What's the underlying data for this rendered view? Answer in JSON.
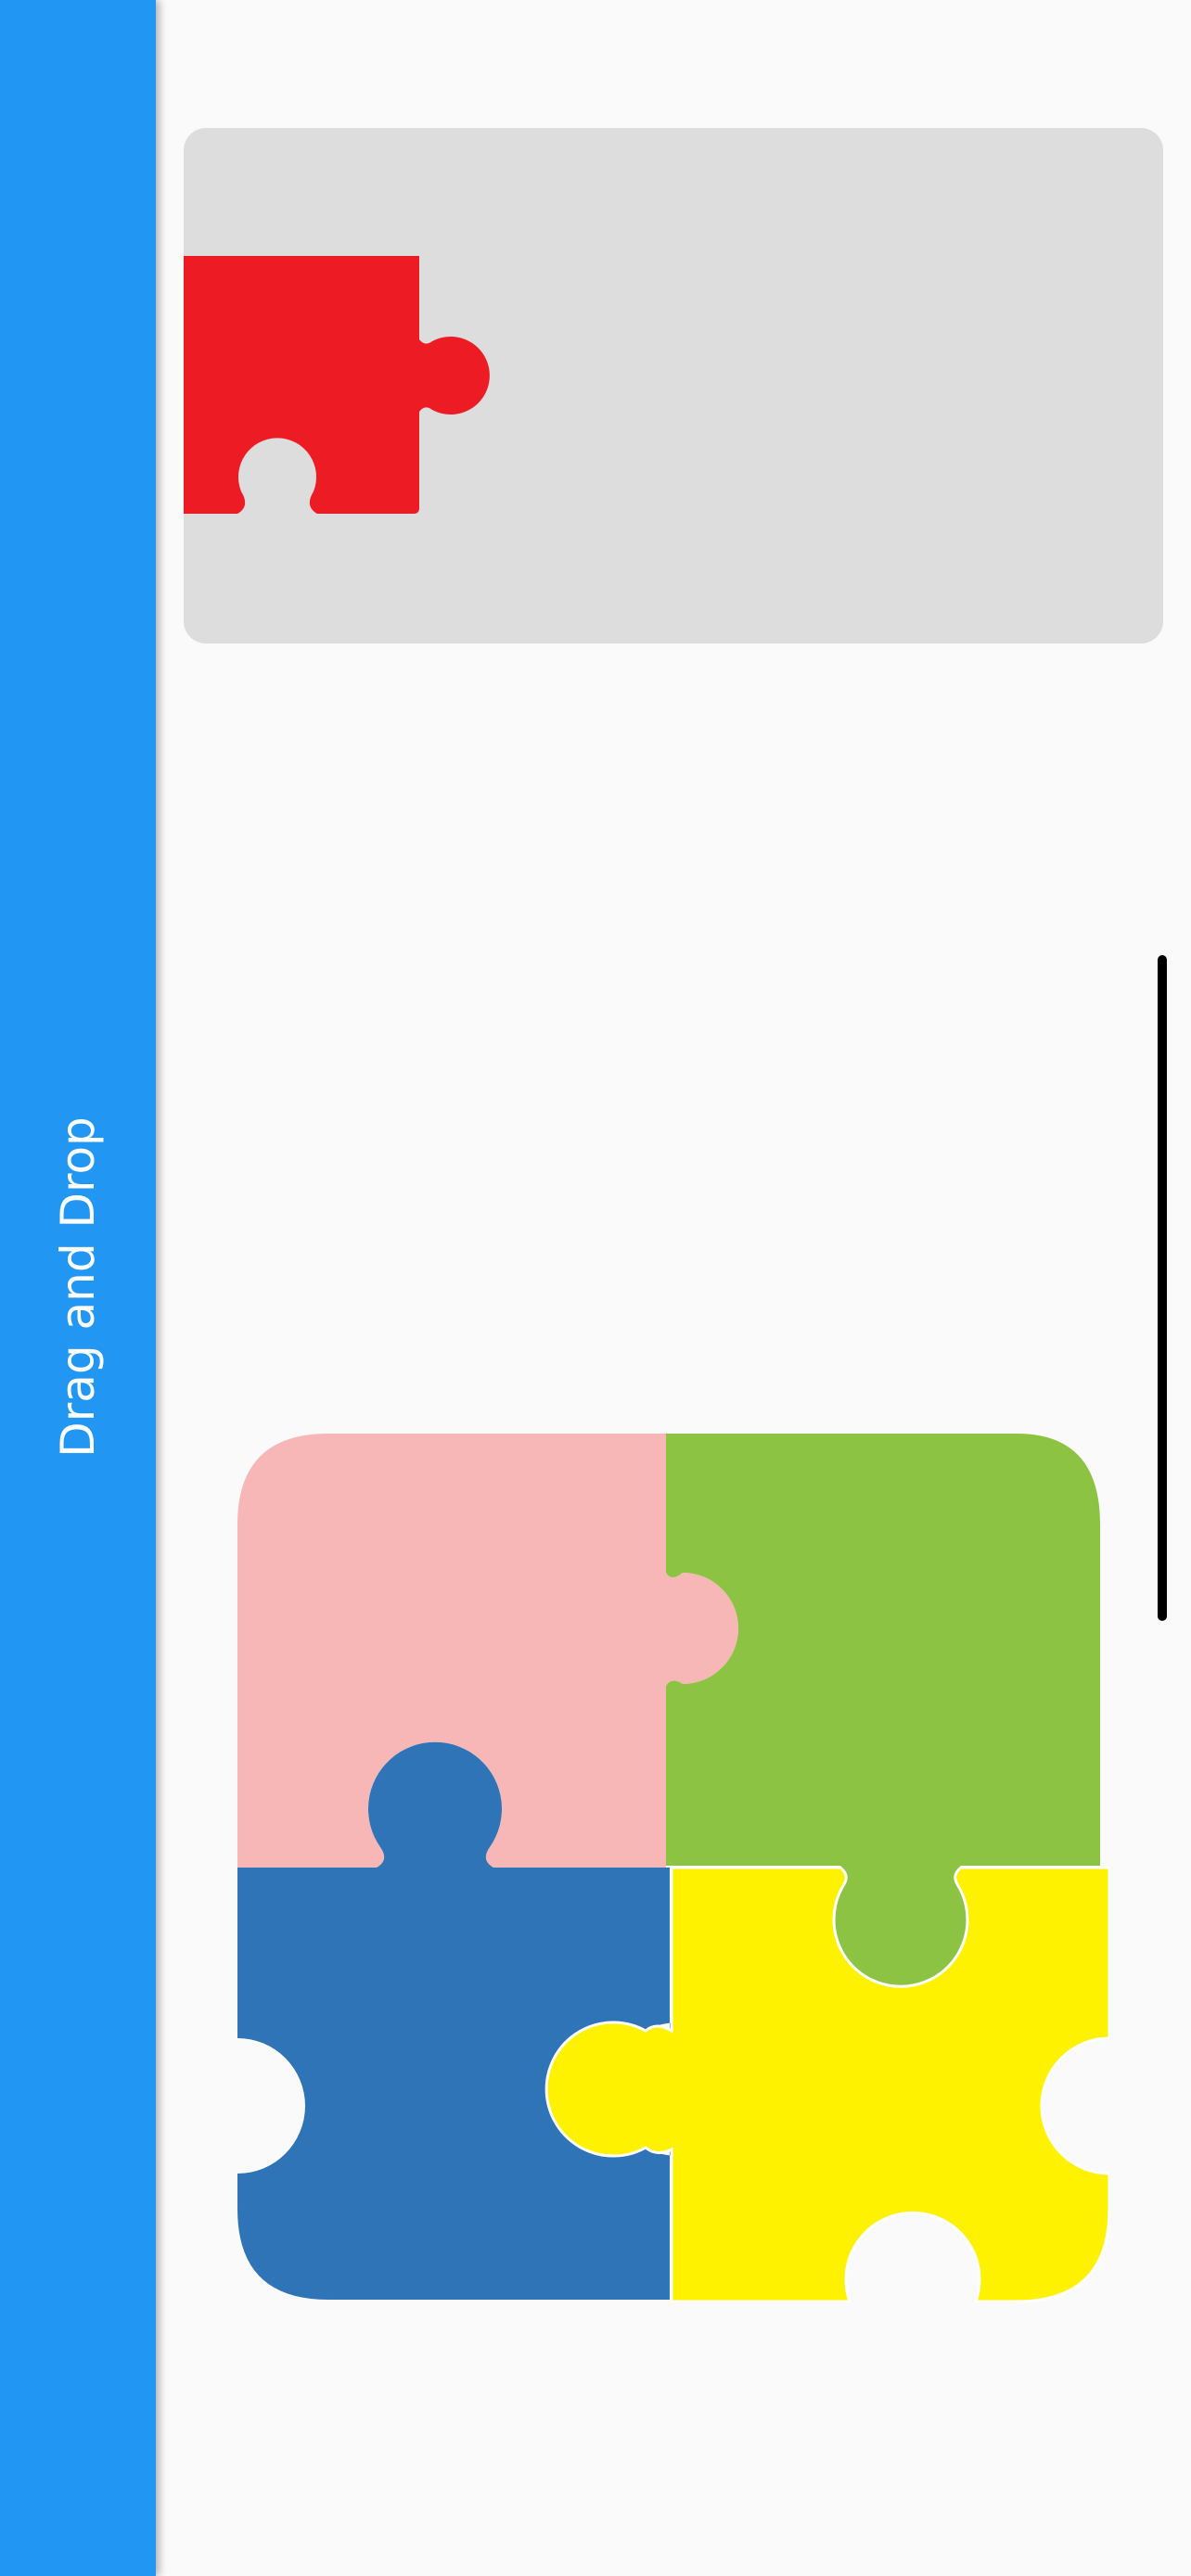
{
  "app_bar": {
    "title": "Drag and Drop",
    "color": "#2196f3"
  },
  "drag_source": {
    "background_color": "#dddddd",
    "piece": {
      "color": "#ed1c24"
    }
  },
  "puzzle_board": {
    "pieces": [
      {
        "position": "top-left",
        "color": "#f7b7b6"
      },
      {
        "position": "top-right",
        "color": "#8dc342"
      },
      {
        "position": "bottom-left",
        "color": "#2e74b6"
      },
      {
        "position": "bottom-right",
        "color": "#fff200"
      }
    ]
  },
  "scroll_indicator": {
    "color": "#000000"
  }
}
